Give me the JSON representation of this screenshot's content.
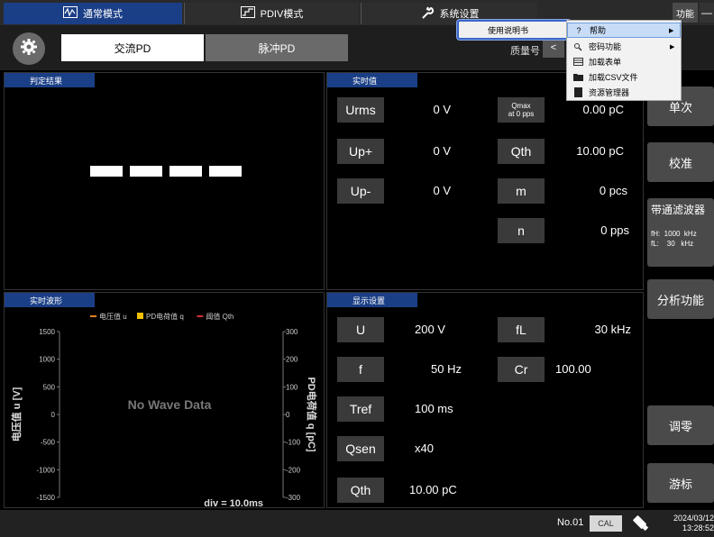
{
  "mode_tabs": [
    {
      "label": "通常模式",
      "icon": "wave-monitor-icon"
    },
    {
      "label": "PDIV模式",
      "icon": "rising-graph-icon"
    },
    {
      "label": "系统设置",
      "icon": "wrench-icon"
    }
  ],
  "top_right": {
    "func_label": "功能",
    "minimize_label": "—"
  },
  "pd_tabs": {
    "ac": "交流PD",
    "pulse": "脉冲PD"
  },
  "model_label": "质量号",
  "model_arrow": "<",
  "panels": {
    "judge": "判定结果",
    "realtime": "实时值",
    "waveform": "实时波形",
    "display": "显示设置"
  },
  "realtime": {
    "urms": {
      "label": "Urms",
      "value": "0 V"
    },
    "up_plus": {
      "label": "Up+",
      "value": "0 V"
    },
    "up_minus": {
      "label": "Up-",
      "value": "0 V"
    },
    "qmax": {
      "label_line1": "Qmax",
      "label_line2": "at 0 pps",
      "value": "0.00 pC"
    },
    "qth": {
      "label": "Qth",
      "value": "10.00 pC"
    },
    "m": {
      "label": "m",
      "value": "0 pcs"
    },
    "n": {
      "label": "n",
      "value": "0 pps"
    }
  },
  "display": {
    "u": {
      "label": "U",
      "value": "200 V"
    },
    "f": {
      "label": "f",
      "value": "50 Hz"
    },
    "tref": {
      "label": "Tref",
      "value": "100 ms"
    },
    "qsen": {
      "label": "Qsen",
      "value": "x40"
    },
    "qth": {
      "label": "Qth",
      "value": "10.00 pC"
    },
    "fl": {
      "label": "fL",
      "value": "30 kHz"
    },
    "cr": {
      "label": "Cr",
      "value": "100.00"
    }
  },
  "side_buttons": {
    "single": "单次",
    "calibrate": "校准",
    "bandpass": "带通滤波器",
    "fh": "fH:  1000  kHz",
    "fl": "fL:    30   kHz",
    "analysis": "分析功能",
    "zero": "调零",
    "cursor": "游标"
  },
  "status": {
    "no": "No.01",
    "cal": "CAL",
    "date": "2024/03/12",
    "time": "13:28:52"
  },
  "menu1": {
    "label": "使用说明书"
  },
  "menu2": [
    {
      "label": "帮助",
      "icon": "question-icon",
      "arrow": "▶"
    },
    {
      "label": "密码功能",
      "icon": "key-search-icon",
      "arrow": "▶"
    },
    {
      "label": "加载表单",
      "icon": "table-icon",
      "arrow": ""
    },
    {
      "label": "加载CSV文件",
      "icon": "folder-icon",
      "arrow": ""
    },
    {
      "label": "资源管理器",
      "icon": "document-icon",
      "arrow": ""
    }
  ],
  "chart_data": {
    "type": "line",
    "title": "",
    "legend": [
      "电压值 u",
      "PD电荷值 q",
      "阈值 Qth"
    ],
    "legend_colors": [
      "#e08020",
      "#f0c000",
      "#d03030"
    ],
    "no_data_text": "No Wave Data",
    "xlabel": "div = 10.0ms",
    "ylabel_left": "电压值 u [V]",
    "ylabel_right": "PD电荷值 q [pC]",
    "y_left_ticks": [
      "1500",
      "1000",
      "500",
      "0",
      "-500",
      "-1000",
      "-1500"
    ],
    "y_right_ticks": [
      "300",
      "200",
      "100",
      "0",
      "-100",
      "-200",
      "-300"
    ],
    "ylim_left": [
      -1500,
      1500
    ],
    "ylim_right": [
      -300,
      300
    ],
    "series": []
  }
}
